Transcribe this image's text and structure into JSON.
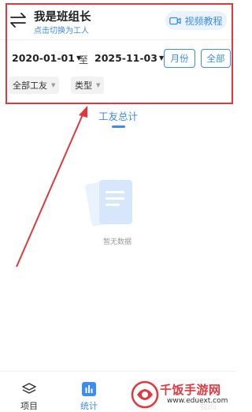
{
  "header": {
    "title": "我是班组长",
    "subtitle": "点击切换为工人",
    "video_label": "视频教程"
  },
  "filters": {
    "start_date": "2020-01-01",
    "separator": "至",
    "end_date": "2025-11-03",
    "month_label": "月份",
    "all_label": "全部",
    "worker_filter": "全部工友",
    "type_filter": "类型"
  },
  "tab": {
    "label": "工友总计"
  },
  "empty": {
    "text": "暂无数据"
  },
  "nav": {
    "items": [
      {
        "label": "项目",
        "icon": "layers-icon"
      },
      {
        "label": "统计",
        "icon": "bar-chart-icon"
      },
      {
        "label": "我的",
        "icon": "user-icon"
      }
    ]
  },
  "watermark": {
    "title": "千饭手游网",
    "url": "www.eduext.com"
  },
  "colors": {
    "accent": "#3d8cf2",
    "annotation": "#e0383e"
  }
}
